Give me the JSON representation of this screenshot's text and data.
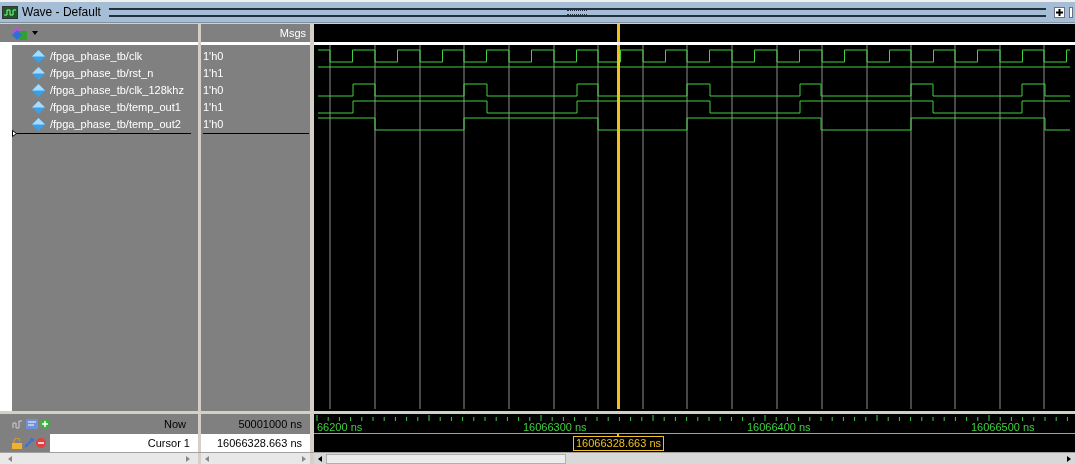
{
  "window": {
    "title": "Wave - Default"
  },
  "header": {
    "msgs_label": "Msgs"
  },
  "signals": [
    {
      "name": "/fpga_phase_tb/clk",
      "value": "1'h0"
    },
    {
      "name": "/fpga_phase_tb/rst_n",
      "value": "1'h1"
    },
    {
      "name": "/fpga_phase_tb/clk_128khz",
      "value": "1'h0"
    },
    {
      "name": "/fpga_phase_tb/temp_out1",
      "value": "1'h1"
    },
    {
      "name": "/fpga_phase_tb/temp_out2",
      "value": "1'h0"
    }
  ],
  "now": {
    "label": "Now",
    "value": "50001000 ns"
  },
  "cursor": {
    "label": "Cursor 1",
    "value": "16066328.663 ns",
    "flag": "16066328.663 ns"
  },
  "time_axis": {
    "labels": [
      "66200 ns",
      "16066300 ns",
      "16066400 ns",
      "16066500 ns"
    ]
  }
}
